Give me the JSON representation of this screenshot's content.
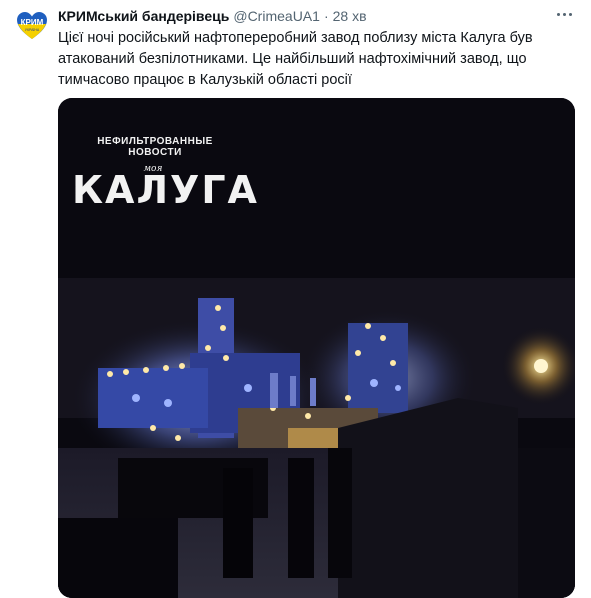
{
  "tweet": {
    "display_name": "КРИМський бандерівець",
    "handle": "@CrimeaUA1",
    "separator": "·",
    "time": "28 хв",
    "text": "Цієї ночі російський нафтопереробний завод поблизу міста Калуга був атакований безпілотниками. Це найбільший нафтохімічний завод, що тимчасово працює в Калузькій області росії",
    "avatar_text": "КРИМ",
    "avatar_subtext": "УКРАЇНА"
  },
  "media": {
    "watermark_top": "Нефильтрованные новости",
    "watermark_mid": "моя",
    "watermark_big": "КАЛУГА"
  },
  "colors": {
    "text": "#0f1419",
    "secondary": "#536471",
    "video_bg": "#0a0910",
    "light_glow": "#8fa8ff"
  }
}
